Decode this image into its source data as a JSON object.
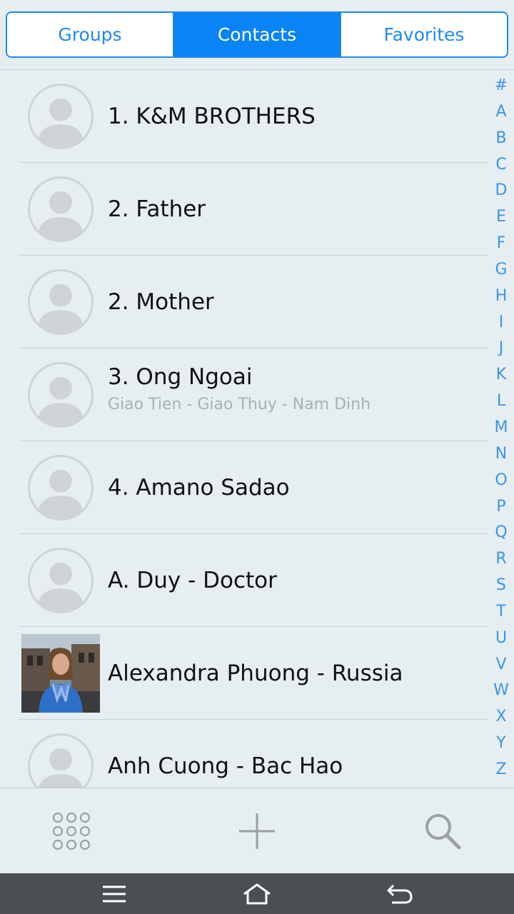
{
  "tabs": [
    {
      "label": "Groups",
      "active": false
    },
    {
      "label": "Contacts",
      "active": true
    },
    {
      "label": "Favorites",
      "active": false
    }
  ],
  "contacts": [
    {
      "name": "1. K&M BROTHERS",
      "subtitle": "",
      "avatar": "default-avatar-icon"
    },
    {
      "name": "2. Father",
      "subtitle": "",
      "avatar": "default-avatar-icon"
    },
    {
      "name": "2. Mother",
      "subtitle": "",
      "avatar": "default-avatar-icon"
    },
    {
      "name": "3. Ong Ngoai",
      "subtitle": "Giao Tien - Giao Thuy - Nam Dinh",
      "avatar": "default-avatar-icon"
    },
    {
      "name": "4. Amano Sadao",
      "subtitle": "",
      "avatar": "default-avatar-icon"
    },
    {
      "name": "A. Duy - Doctor",
      "subtitle": "",
      "avatar": "default-avatar-icon"
    },
    {
      "name": "Alexandra Phuong - Russia",
      "subtitle": "",
      "avatar": "contact-photo"
    },
    {
      "name": "Anh Cuong - Bac Hao",
      "subtitle": "",
      "avatar": "default-avatar-icon"
    }
  ],
  "index_letters": [
    "#",
    "A",
    "B",
    "C",
    "D",
    "E",
    "F",
    "G",
    "H",
    "I",
    "J",
    "K",
    "L",
    "M",
    "N",
    "O",
    "P",
    "Q",
    "R",
    "S",
    "T",
    "U",
    "V",
    "W",
    "X",
    "Y",
    "Z"
  ],
  "toolbar": {
    "dialpad_icon": "dialpad-icon",
    "add_icon": "add-icon",
    "search_icon": "search-icon"
  },
  "navbar": {
    "menu_icon": "menu-icon",
    "home_icon": "home-icon",
    "back_icon": "back-icon"
  },
  "colors": {
    "accent": "#0a84f5",
    "index_text": "#3a95ee",
    "background": "#e6eef1",
    "navbar": "#4a4f53"
  }
}
